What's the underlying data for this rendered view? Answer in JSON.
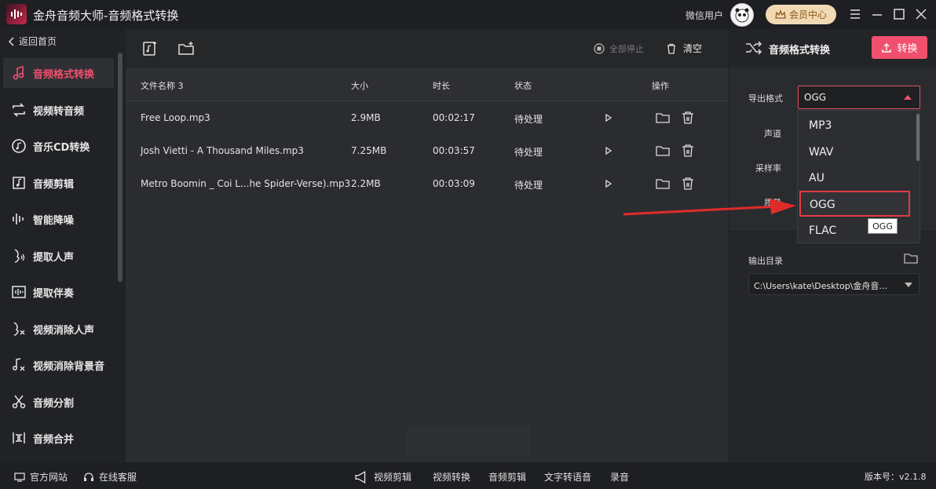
{
  "app": {
    "title": "金舟音频大师-音频格式转换",
    "user_name": "微信用户",
    "vip_label": "会员中心"
  },
  "sidebar": {
    "back_label": "返回首页",
    "items": [
      {
        "label": "音频格式转换",
        "icon": "music-note-icon",
        "active": true
      },
      {
        "label": "视频转音频",
        "icon": "convert-arrows-icon"
      },
      {
        "label": "音乐CD转换",
        "icon": "cd-icon"
      },
      {
        "label": "音频剪辑",
        "icon": "music-edit-icon"
      },
      {
        "label": "智能降噪",
        "icon": "waveform-icon"
      },
      {
        "label": "提取人声",
        "icon": "voice-icon"
      },
      {
        "label": "提取伴奏",
        "icon": "accompaniment-icon"
      },
      {
        "label": "视频消除人声",
        "icon": "remove-voice-icon"
      },
      {
        "label": "视频消除背景音",
        "icon": "remove-bg-icon"
      },
      {
        "label": "音频分割",
        "icon": "scissors-icon"
      },
      {
        "label": "音频合并",
        "icon": "merge-icon"
      }
    ]
  },
  "toolbar": {
    "stop_all_label": "全部停止",
    "clear_label": "清空"
  },
  "table": {
    "columns": [
      "文件名称 3",
      "大小",
      "时长",
      "状态",
      "操作"
    ],
    "rows": [
      {
        "name": "Free Loop.mp3",
        "size": "2.9MB",
        "duration": "00:02:17",
        "status": "待处理"
      },
      {
        "name": "Josh Vietti - A Thousand Miles.mp3",
        "size": "7.25MB",
        "duration": "00:03:57",
        "status": "待处理"
      },
      {
        "name": "Metro Boomin _ Coi L...he Spider-Verse).mp3",
        "size": "2.2MB",
        "duration": "00:03:09",
        "status": "待处理"
      }
    ]
  },
  "right_panel": {
    "title": "音频格式转换",
    "convert_label": "转换",
    "export_format_label": "导出格式",
    "export_format_value": "OGG",
    "channel_label": "声道",
    "sample_rate_label": "采样率",
    "quality_label": "质量",
    "format_options": [
      "MP3",
      "WAV",
      "AU",
      "OGG",
      "FLAC"
    ],
    "selected_option": "OGG",
    "tooltip": "OGG",
    "output_dir_label": "输出目录",
    "output_dir_value": "C:\\Users\\kate\\Desktop\\金舟音..."
  },
  "bottombar": {
    "website_label": "官方网站",
    "support_label": "在线客服",
    "links": [
      "视频剪辑",
      "视频转换",
      "音频剪辑",
      "文字转语音",
      "录音"
    ],
    "version": "版本号：v2.1.8"
  },
  "colors": {
    "accent": "#f0506e",
    "highlight_border": "#e23b44"
  }
}
